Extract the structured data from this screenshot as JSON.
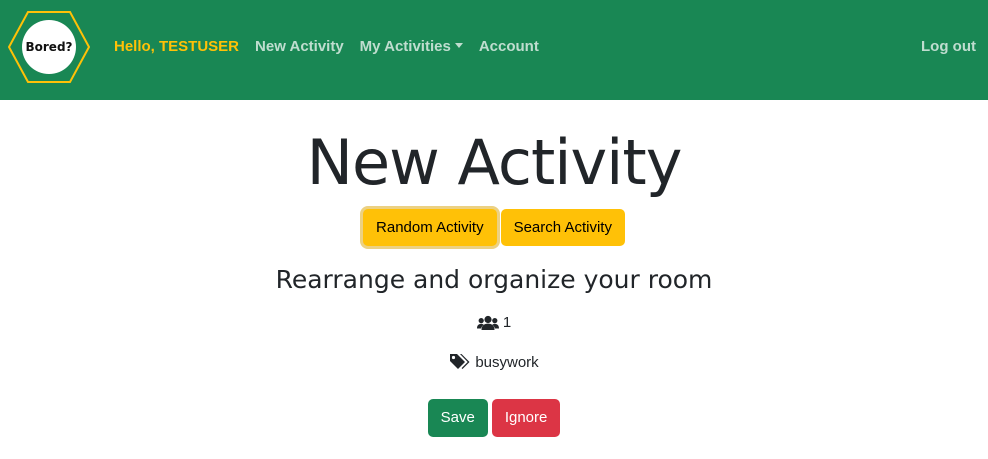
{
  "logo": {
    "text": "Bored?"
  },
  "nav": {
    "greeting": "Hello, TESTUSER",
    "new_activity": "New Activity",
    "my_activities": "My Activities",
    "account": "Account",
    "logout": "Log out"
  },
  "page": {
    "title": "New Activity"
  },
  "mode_buttons": {
    "random": "Random Activity",
    "search": "Search Activity"
  },
  "activity": {
    "name": "Rearrange and organize your room",
    "participants": "1",
    "type": "busywork"
  },
  "actions": {
    "save": "Save",
    "ignore": "Ignore"
  },
  "icons": {
    "participants": "users-icon",
    "type": "tags-icon"
  },
  "colors": {
    "navbar": "#198754",
    "accent": "#ffc107",
    "danger": "#dc3545"
  }
}
